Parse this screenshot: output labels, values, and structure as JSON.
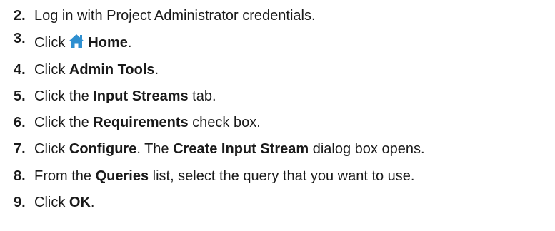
{
  "steps": [
    {
      "number": "2.",
      "parts": [
        {
          "text": "Log in with Project Administrator credentials.",
          "bold": false
        }
      ]
    },
    {
      "number": "3.",
      "parts": [
        {
          "text": "Click",
          "bold": false
        },
        {
          "icon": "home-icon"
        },
        {
          "text": "Home",
          "bold": true
        },
        {
          "text": ".",
          "bold": false
        }
      ]
    },
    {
      "number": "4.",
      "parts": [
        {
          "text": "Click ",
          "bold": false
        },
        {
          "text": "Admin Tools",
          "bold": true
        },
        {
          "text": ".",
          "bold": false
        }
      ]
    },
    {
      "number": "5.",
      "parts": [
        {
          "text": "Click the ",
          "bold": false
        },
        {
          "text": "Input Streams",
          "bold": true
        },
        {
          "text": " tab.",
          "bold": false
        }
      ]
    },
    {
      "number": "6.",
      "parts": [
        {
          "text": "Click the ",
          "bold": false
        },
        {
          "text": "Requirements",
          "bold": true
        },
        {
          "text": " check box.",
          "bold": false
        }
      ]
    },
    {
      "number": "7.",
      "parts": [
        {
          "text": "Click ",
          "bold": false
        },
        {
          "text": "Configure",
          "bold": true
        },
        {
          "text": ". The ",
          "bold": false
        },
        {
          "text": "Create Input Stream",
          "bold": true
        },
        {
          "text": " dialog box opens.",
          "bold": false
        }
      ]
    },
    {
      "number": "8.",
      "parts": [
        {
          "text": "From the ",
          "bold": false
        },
        {
          "text": "Queries",
          "bold": true
        },
        {
          "text": " list, select the query that you want to use.",
          "bold": false
        }
      ]
    },
    {
      "number": "9.",
      "parts": [
        {
          "text": "Click ",
          "bold": false
        },
        {
          "text": "OK",
          "bold": true
        },
        {
          "text": ".",
          "bold": false
        }
      ]
    }
  ],
  "colors": {
    "text": "#1a1a1a",
    "home_icon": "#2e8fd0"
  }
}
